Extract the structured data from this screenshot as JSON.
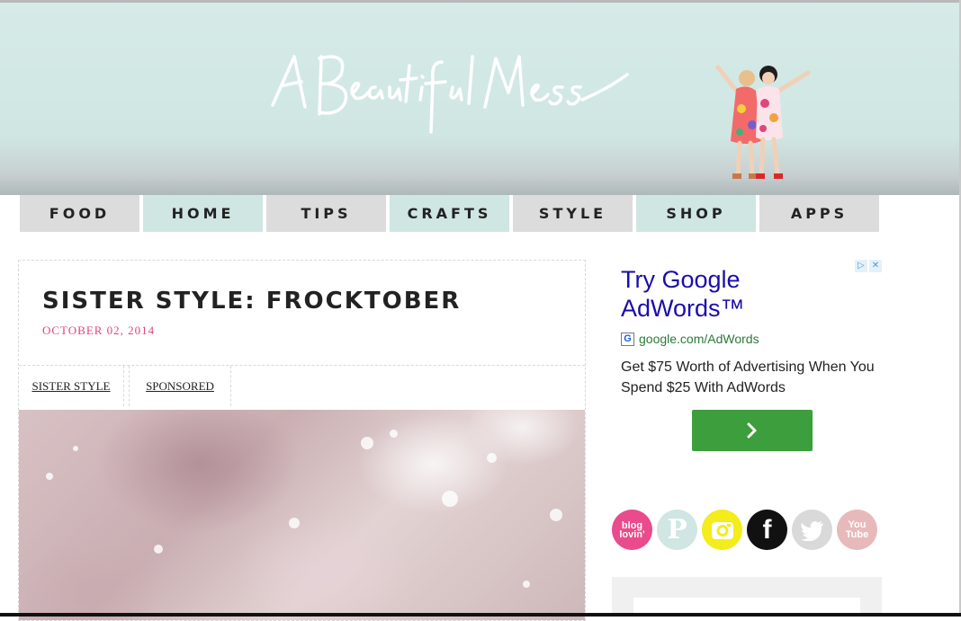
{
  "header": {
    "logo_text": "A Beautiful Mess"
  },
  "nav": {
    "items": [
      {
        "label": "FOOD",
        "color": "#dcdcdc"
      },
      {
        "label": "HOME",
        "color": "#cfe6e2"
      },
      {
        "label": "TIPS",
        "color": "#dcdcdc"
      },
      {
        "label": "CRAFTS",
        "color": "#cfe6e2"
      },
      {
        "label": "STYLE",
        "color": "#dcdcdc"
      },
      {
        "label": "SHOP",
        "color": "#cfe6e2"
      },
      {
        "label": "APPS",
        "color": "#dcdcdc"
      }
    ]
  },
  "post": {
    "title": "SISTER STYLE: FROCKTOBER",
    "date": "OCTOBER 02, 2014",
    "date_color": "#e0467c",
    "tags": [
      "SISTER STYLE",
      "SPONSORED"
    ]
  },
  "ad": {
    "choices_icons": [
      "play-icon",
      "close-icon"
    ],
    "headline": "Try Google AdWords™",
    "display_url": "google.com/AdWords",
    "body": "Get $75 Worth of Advertising When You Spend $25 With AdWords",
    "cta_icon": "chevron-right-icon",
    "cta_color": "#3c9e3c"
  },
  "social": {
    "icons": [
      {
        "name": "bloglovin-icon",
        "text": "blog lovin'",
        "color": "#e94b8c"
      },
      {
        "name": "pinterest-icon",
        "text": "P",
        "color": "#cfe6e2"
      },
      {
        "name": "instagram-icon",
        "color": "#f4ec1b"
      },
      {
        "name": "facebook-icon",
        "text": "f",
        "color": "#111111"
      },
      {
        "name": "twitter-icon",
        "color": "#d9d9d9"
      },
      {
        "name": "youtube-icon",
        "text": "You Tube",
        "color": "#e8b9bb"
      }
    ]
  }
}
